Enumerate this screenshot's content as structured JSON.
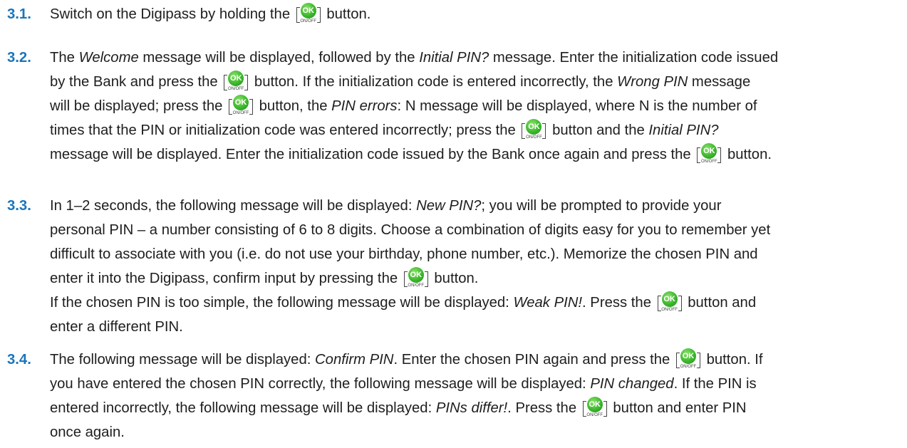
{
  "button": {
    "ok_label": "OK",
    "onoff_label": "ON/OFF",
    "icon": "ok-on-off-button-icon",
    "color": "#3cb72c"
  },
  "accent_color": "#1a75bc",
  "steps": [
    {
      "number": "3.1.",
      "lines": [
        {
          "segments": [
            {
              "t": "Switch on the Digipass by holding the "
            },
            {
              "btn": true
            },
            {
              "t": " button."
            }
          ]
        }
      ]
    },
    {
      "number": "3.2.",
      "lines": [
        {
          "segments": [
            {
              "t": "The "
            },
            {
              "t": "Welcome",
              "i": true
            },
            {
              "t": " message will be displayed, followed by the "
            },
            {
              "t": "Initial PIN?",
              "i": true
            },
            {
              "t": " message. Enter the initialization code issued"
            }
          ]
        },
        {
          "segments": [
            {
              "t": "by the Bank and press the "
            },
            {
              "btn": true
            },
            {
              "t": " button. If the initialization code is entered incorrectly, the "
            },
            {
              "t": "Wrong PIN",
              "i": true
            },
            {
              "t": " message"
            }
          ]
        },
        {
          "segments": [
            {
              "t": "will be displayed; press the "
            },
            {
              "btn": true
            },
            {
              "t": " button, the "
            },
            {
              "t": "PIN errors",
              "i": true
            },
            {
              "t": ": N message will be displayed, where N is the number of"
            }
          ]
        },
        {
          "segments": [
            {
              "t": "times that the PIN or initialization code was entered incorrectly; press the "
            },
            {
              "btn": true
            },
            {
              "t": " button and the "
            },
            {
              "t": "Initial PIN?",
              "i": true
            }
          ]
        },
        {
          "segments": [
            {
              "t": "message will be displayed. Enter the initialization code issued by the Bank once again and press the "
            },
            {
              "btn": true
            },
            {
              "t": " button."
            }
          ]
        }
      ]
    },
    {
      "number": "3.3.",
      "lines": [
        {
          "segments": [
            {
              "t": "In 1–2 seconds, the following message will be displayed: "
            },
            {
              "t": "New PIN?",
              "i": true
            },
            {
              "t": "; you will be prompted to provide your"
            }
          ]
        },
        {
          "segments": [
            {
              "t": "personal PIN – a number consisting of 6 to 8 digits. Choose a combination of digits easy for you to remember yet"
            }
          ]
        },
        {
          "segments": [
            {
              "t": "difficult to associate with you (i.e. do not use your birthday, phone number, etc.). Memorize the chosen PIN and"
            }
          ]
        },
        {
          "segments": [
            {
              "t": "enter it into the Digipass, confirm input by pressing the "
            },
            {
              "btn": true
            },
            {
              "t": " button."
            }
          ]
        },
        {
          "segments": [
            {
              "t": "If the chosen PIN is too simple, the following message will be displayed: "
            },
            {
              "t": "Weak PIN!",
              "i": true
            },
            {
              "t": ". Press the "
            },
            {
              "btn": true
            },
            {
              "t": " button and"
            }
          ]
        },
        {
          "segments": [
            {
              "t": "enter a different PIN."
            }
          ]
        }
      ]
    },
    {
      "number": "3.4.",
      "lines": [
        {
          "segments": [
            {
              "t": "The following message will be displayed: "
            },
            {
              "t": "Confirm PIN",
              "i": true
            },
            {
              "t": ". Enter the chosen PIN again and press the "
            },
            {
              "btn": true
            },
            {
              "t": " button. If"
            }
          ]
        },
        {
          "segments": [
            {
              "t": "you have entered the chosen PIN correctly, the following message will be displayed: "
            },
            {
              "t": "PIN changed",
              "i": true
            },
            {
              "t": ". If the PIN is"
            }
          ]
        },
        {
          "segments": [
            {
              "t": "entered incorrectly, the following message will be displayed: "
            },
            {
              "t": "PINs differ!",
              "i": true
            },
            {
              "t": ". Press the "
            },
            {
              "btn": true
            },
            {
              "t": " button and enter PIN"
            }
          ]
        },
        {
          "segments": [
            {
              "t": "once again."
            }
          ]
        }
      ]
    }
  ]
}
